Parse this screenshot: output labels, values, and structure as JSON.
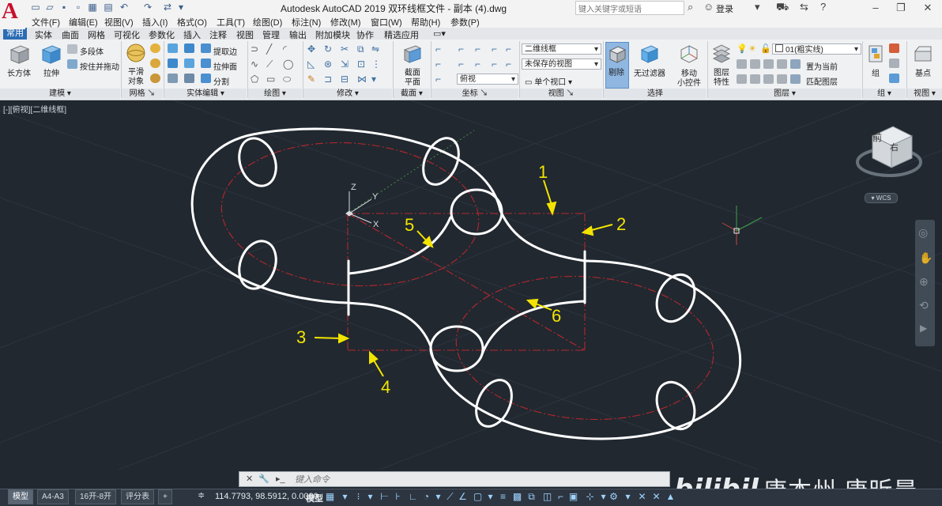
{
  "window": {
    "title": "Autodesk AutoCAD 2019    双环线框文件 - 副本 (4).dwg",
    "search_placeholder": "键入关键字或短语",
    "login_label": "登录"
  },
  "menu": [
    "文件(F)",
    "编辑(E)",
    "视图(V)",
    "插入(I)",
    "格式(O)",
    "工具(T)",
    "绘图(D)",
    "标注(N)",
    "修改(M)",
    "窗口(W)",
    "帮助(H)",
    "参数(P)"
  ],
  "ribbon_tabs": [
    "常用",
    "实体",
    "曲面",
    "网格",
    "可视化",
    "参数化",
    "插入",
    "注释",
    "视图",
    "管理",
    "输出",
    "附加模块",
    "协作",
    "精选应用"
  ],
  "ribbon": {
    "modeling": {
      "box": "长方体",
      "extrude": "拉伸",
      "polysolid": "多段体",
      "presspull": "按住并拖动",
      "title": "建模"
    },
    "mesh": {
      "smooth": "平滑",
      "smooth2": "对象",
      "title": "网格"
    },
    "solid_edit": {
      "extract_edges": "提取边",
      "extrude_face": "拉伸面",
      "separate": "分割",
      "title": "实体编辑"
    },
    "draw": {
      "title": "绘图"
    },
    "modify": {
      "title": "修改"
    },
    "section": {
      "plane": "截面",
      "plane2": "平面",
      "title": "截面"
    },
    "coords": {
      "ucs_view": "俯视",
      "title": "坐标"
    },
    "view": {
      "visual_style": "二维线框",
      "saved_view": "未保存的视图",
      "single_viewport": "单个视口",
      "title": "视图"
    },
    "selection": {
      "cull": "剔除",
      "no_filter": "无过滤器",
      "title": "选择"
    },
    "gizmo": {
      "move": "移动",
      "move2": "小控件"
    },
    "layers": {
      "properties": "图层",
      "properties2": "特性",
      "current_layer": "01(粗实线)",
      "set_current": "置为当前",
      "match": "匹配图层",
      "title": "图层"
    },
    "groups": {
      "group": "组",
      "title": "组"
    },
    "view2": {
      "base": "基点",
      "title": "视图"
    }
  },
  "viewport": {
    "label": "[-][俯视][二维线框]",
    "viewcube_face": "前",
    "viewcube_right": "右",
    "wcs": "WCS"
  },
  "ucs_icon": {
    "z": "Z",
    "y": "Y",
    "x": "X"
  },
  "annotations": [
    "1",
    "2",
    "3",
    "4",
    "5",
    "6"
  ],
  "command_line": {
    "placeholder": "键入命令"
  },
  "status": {
    "layout_tabs": [
      "模型",
      "A4-A3",
      "16开-8开",
      "评分表"
    ],
    "coords": "114.7793, 98.5912, 0.0000",
    "mode": "模型"
  },
  "watermark": {
    "text": "唐本州 唐昕晨"
  }
}
